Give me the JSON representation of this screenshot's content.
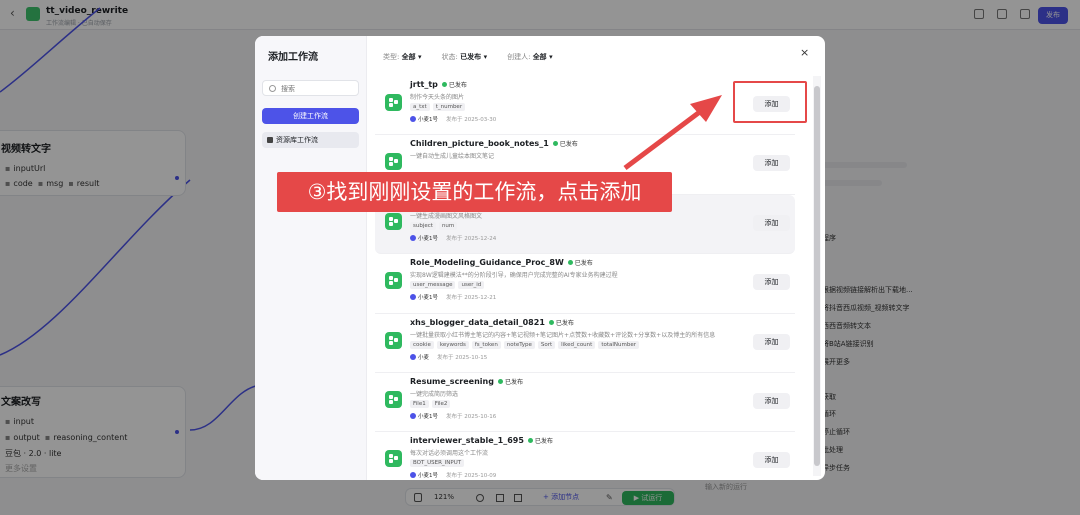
{
  "app": {
    "title": "tt_video_rewrite",
    "subtitle": "工作流编辑 · 已自动保存",
    "publish_label": "发布"
  },
  "canvas": {
    "node1": {
      "title": "视频转文字",
      "input": "inputUrl",
      "outputs": [
        "code",
        "msg",
        "result"
      ]
    },
    "node2": {
      "title": "文案改写",
      "input_tag": "input",
      "output_tag": "output",
      "extra_tag": "reasoning_content",
      "model": "豆包 · 2.0 · lite",
      "more": "更多设置"
    },
    "right_panel": [
      "程序",
      "根据视频链接解析出下载地...",
      "将抖音西瓜视频_视频转文字",
      "西西音频转文本",
      "将B站A链接识别",
      "展开更多",
      "获取",
      "循环",
      "停止循环",
      "批处理",
      "异步任务"
    ],
    "zoom": "121%",
    "add_node": "+ 添加节点",
    "run": "▶ 试运行",
    "hint": "输入新的运行"
  },
  "modal": {
    "title": "添加工作流",
    "search_placeholder": "搜索",
    "create_label": "创建工作流",
    "library_label": "资源库工作流",
    "filters": [
      {
        "label": "类型:",
        "value": "全部 ▾"
      },
      {
        "label": "状态:",
        "value": "已发布 ▾"
      },
      {
        "label": "创建人:",
        "value": "全部 ▾"
      }
    ],
    "close": "×",
    "add_label": "添加",
    "status_label": "已发布",
    "items": [
      {
        "name": "jrtt_tp",
        "desc": "制作今天头条的图片",
        "tags": [
          "a_txt",
          "t_number"
        ],
        "author": "小麦1号",
        "date": "发布于 2025-03-30"
      },
      {
        "name": "Children_picture_book_notes_1",
        "desc": "一键自动生成儿童绘本图文笔记",
        "tags": [],
        "author": "",
        "date": ""
      },
      {
        "name": "",
        "desc": "一键生成漫画图文风格图文",
        "tags": [
          "subject",
          "num"
        ],
        "author": "小麦1号",
        "date": "发布于 2025-12-24"
      },
      {
        "name": "Role_Modeling_Guidance_Proc_8W",
        "desc": "实现8W逻辑建模法**的分阶段引导，确保用户完成完整的AI专家业务构建过程",
        "tags": [
          "user_message",
          "user_id"
        ],
        "author": "小麦1号",
        "date": "发布于 2025-12-21"
      },
      {
        "name": "xhs_blogger_data_detail_0821",
        "desc": "一键批量获取小红书博主笔记的内容+笔记视频+笔记图片+点赞数+收藏数+评论数+分享数+以及博主的所有信息",
        "tags": [
          "cookie",
          "keywords",
          "fs_token",
          "noteType",
          "Sort",
          "liked_count",
          "totalNumber"
        ],
        "author": "小麦",
        "date": "发布于 2025-10-15"
      },
      {
        "name": "Resume_screening",
        "desc": "一键完成简历筛选",
        "tags": [
          "File1",
          "File2"
        ],
        "author": "小麦1号",
        "date": "发布于 2025-10-16"
      },
      {
        "name": "interviewer_stable_1_695",
        "desc": "每次对话必须调用这个工作流",
        "tags": [
          "BOT_USER_INPUT"
        ],
        "author": "小麦1号",
        "date": "发布于 2025-10-09"
      }
    ]
  },
  "annotation": {
    "text": "③找到刚刚设置的工作流，点击添加",
    "color": "#e54848"
  },
  "colors": {
    "accent": "#4d53e8",
    "green": "#2fb95f",
    "annotation": "#e54848"
  }
}
